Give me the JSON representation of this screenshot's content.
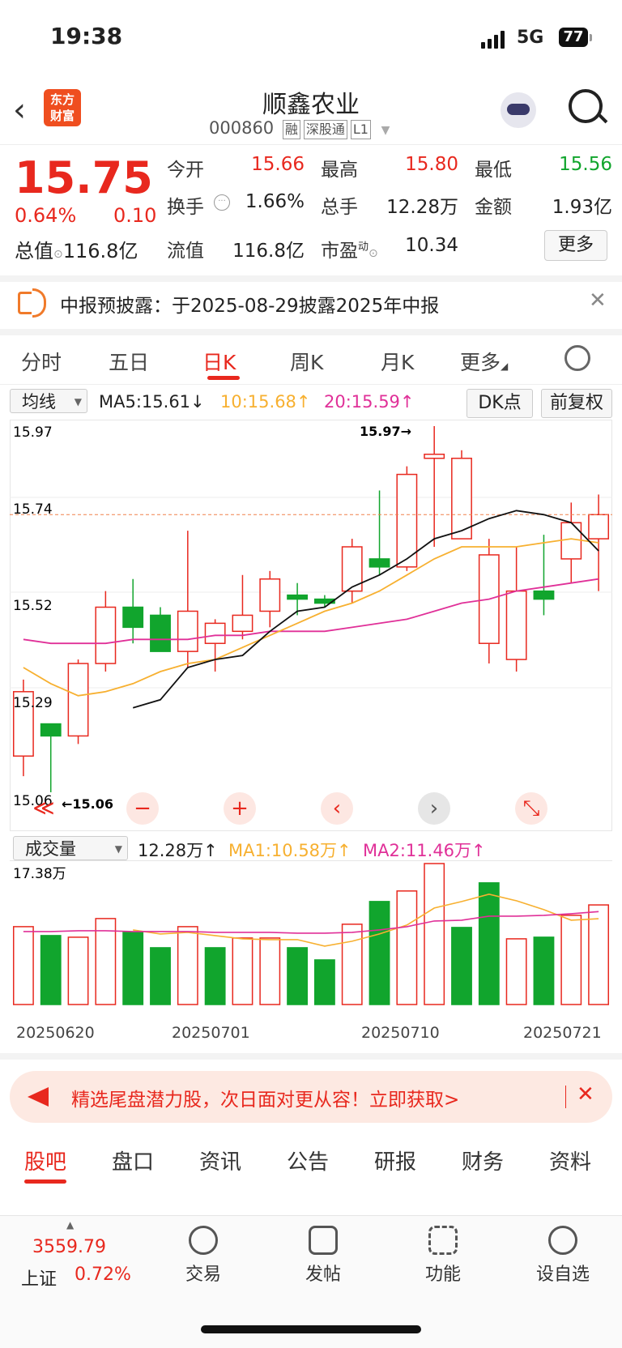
{
  "status": {
    "time": "19:38",
    "network": "5G",
    "battery": "77"
  },
  "header": {
    "logo": "东方\n财富",
    "name": "顺鑫农业",
    "code": "000860",
    "tags": [
      "融",
      "深股通",
      "L1"
    ]
  },
  "quote": {
    "price": "15.75",
    "pct": "0.64%",
    "change": "0.10",
    "items": [
      {
        "label": "今开",
        "value": "15.66",
        "color": "red"
      },
      {
        "label": "最高",
        "value": "15.80",
        "color": "red"
      },
      {
        "label": "最低",
        "value": "15.56",
        "color": "green"
      },
      {
        "label": "换手",
        "value": "1.66%",
        "color": "black"
      },
      {
        "label": "总手",
        "value": "12.28万",
        "color": "black"
      },
      {
        "label": "金额",
        "value": "1.93亿",
        "color": "black"
      },
      {
        "label": "流值",
        "value": "116.8亿",
        "color": "black"
      },
      {
        "label": "市盈",
        "value": "10.34",
        "color": "black"
      }
    ],
    "total_label": "总值",
    "total_value": "116.8亿",
    "pe_sup": "动",
    "more": "更多"
  },
  "notice": {
    "text": "中报预披露：于2025-08-29披露2025年中报"
  },
  "tabs": [
    "分时",
    "五日",
    "日K",
    "周K",
    "月K",
    "更多"
  ],
  "ma_row": {
    "select": "均线",
    "ma5": "MA5:15.61↓",
    "ma10": "10:15.68↑",
    "ma20": "20:15.59↑",
    "dk": "DK点",
    "fq": "前复权"
  },
  "kline_labels": {
    "y_top": "15.97",
    "y2": "15.74",
    "y3": "15.52",
    "y4": "15.29",
    "y_bot": "15.06",
    "max_note": "15.97→",
    "min_note": "←15.06"
  },
  "vol_row": {
    "select": "成交量",
    "vol": "12.28万↑",
    "ma1": "MA1:10.58万↑",
    "ma2": "MA2:11.46万↑",
    "ymax": "17.38万"
  },
  "dates": [
    "20250620",
    "20250701",
    "20250710",
    "20250721"
  ],
  "chart_data": [
    {
      "type": "candlestick",
      "title": "日K",
      "ylim": [
        15.06,
        15.97
      ],
      "x": [
        "2025-06-20",
        "2025-06-23",
        "2025-06-24",
        "2025-06-25",
        "2025-06-26",
        "2025-06-27",
        "2025-06-30",
        "2025-07-01",
        "2025-07-02",
        "2025-07-03",
        "2025-07-04",
        "2025-07-07",
        "2025-07-08",
        "2025-07-09",
        "2025-07-10",
        "2025-07-11",
        "2025-07-14",
        "2025-07-15",
        "2025-07-16",
        "2025-07-17",
        "2025-07-18",
        "2025-07-21"
      ],
      "open": [
        15.15,
        15.23,
        15.2,
        15.38,
        15.52,
        15.5,
        15.41,
        15.43,
        15.46,
        15.51,
        15.55,
        15.54,
        15.56,
        15.64,
        15.62,
        15.89,
        15.69,
        15.43,
        15.39,
        15.56,
        15.64,
        15.69
      ],
      "close": [
        15.31,
        15.2,
        15.38,
        15.52,
        15.47,
        15.41,
        15.51,
        15.48,
        15.5,
        15.59,
        15.54,
        15.53,
        15.67,
        15.62,
        15.85,
        15.9,
        15.89,
        15.65,
        15.56,
        15.54,
        15.73,
        15.75
      ],
      "high": [
        15.34,
        15.21,
        15.39,
        15.56,
        15.59,
        15.52,
        15.71,
        15.49,
        15.6,
        15.61,
        15.58,
        15.55,
        15.69,
        15.81,
        15.87,
        15.97,
        15.91,
        15.69,
        15.67,
        15.7,
        15.78,
        15.8
      ],
      "low": [
        15.1,
        15.06,
        15.18,
        15.36,
        15.43,
        15.41,
        15.37,
        15.36,
        15.44,
        15.47,
        15.5,
        15.52,
        15.53,
        15.6,
        15.61,
        15.67,
        15.8,
        15.38,
        15.36,
        15.5,
        15.58,
        15.56
      ],
      "ma5": [
        null,
        null,
        null,
        null,
        15.27,
        15.29,
        15.37,
        15.39,
        15.4,
        15.46,
        15.51,
        15.52,
        15.57,
        15.6,
        15.64,
        15.69,
        15.71,
        15.74,
        15.76,
        15.75,
        15.73,
        15.66
      ],
      "ma10": [
        15.37,
        15.33,
        15.3,
        15.31,
        15.33,
        15.36,
        15.38,
        15.39,
        15.42,
        15.45,
        15.48,
        15.51,
        15.53,
        15.56,
        15.6,
        15.64,
        15.67,
        15.67,
        15.67,
        15.68,
        15.69,
        15.68
      ],
      "ma20": [
        15.44,
        15.43,
        15.43,
        15.43,
        15.44,
        15.44,
        15.44,
        15.45,
        15.45,
        15.46,
        15.46,
        15.46,
        15.47,
        15.48,
        15.49,
        15.51,
        15.53,
        15.54,
        15.56,
        15.57,
        15.58,
        15.59
      ],
      "colors": {
        "ma5": "#111111",
        "ma10": "#f7b030",
        "ma20": "#e03098",
        "up": "#e8281e",
        "down": "#11a52d"
      }
    },
    {
      "type": "bar",
      "title": "成交量",
      "unit": "万",
      "ylim": [
        0,
        17.38
      ],
      "values": [
        9.6,
        8.5,
        8.3,
        10.6,
        8.9,
        7.0,
        9.6,
        7.0,
        8.2,
        8.2,
        7.0,
        5.5,
        9.9,
        12.7,
        14.0,
        17.38,
        9.5,
        15.0,
        8.1,
        8.3,
        11.0,
        12.28
      ],
      "up": [
        true,
        false,
        true,
        true,
        false,
        false,
        true,
        false,
        true,
        true,
        false,
        false,
        true,
        false,
        true,
        true,
        false,
        false,
        true,
        false,
        true,
        true
      ],
      "ma1": [
        null,
        null,
        null,
        null,
        9.2,
        8.7,
        8.9,
        8.5,
        8.1,
        8.0,
        8.0,
        7.2,
        7.8,
        8.7,
        9.8,
        11.9,
        12.7,
        13.6,
        12.8,
        11.7,
        10.4,
        10.58
      ],
      "ma2": [
        9.0,
        9.0,
        9.1,
        9.1,
        9.0,
        9.0,
        9.0,
        8.9,
        8.9,
        8.9,
        8.8,
        8.8,
        8.9,
        9.2,
        9.6,
        10.3,
        10.4,
        10.9,
        10.9,
        11.0,
        11.2,
        11.46
      ]
    }
  ],
  "controls": [
    "≪",
    "−",
    "+",
    "‹",
    "›",
    "⤡"
  ],
  "promo": {
    "text": "精选尾盘潜力股，次日面对更从容！立即获取>"
  },
  "subtabs": [
    "股吧",
    "盘口",
    "资讯",
    "公告",
    "研报",
    "财务",
    "资料"
  ],
  "bottom": {
    "index_value": "3559.79",
    "index_name": "上证",
    "index_pct": "0.72%",
    "nav": [
      "交易",
      "发帖",
      "功能",
      "设自选"
    ]
  }
}
